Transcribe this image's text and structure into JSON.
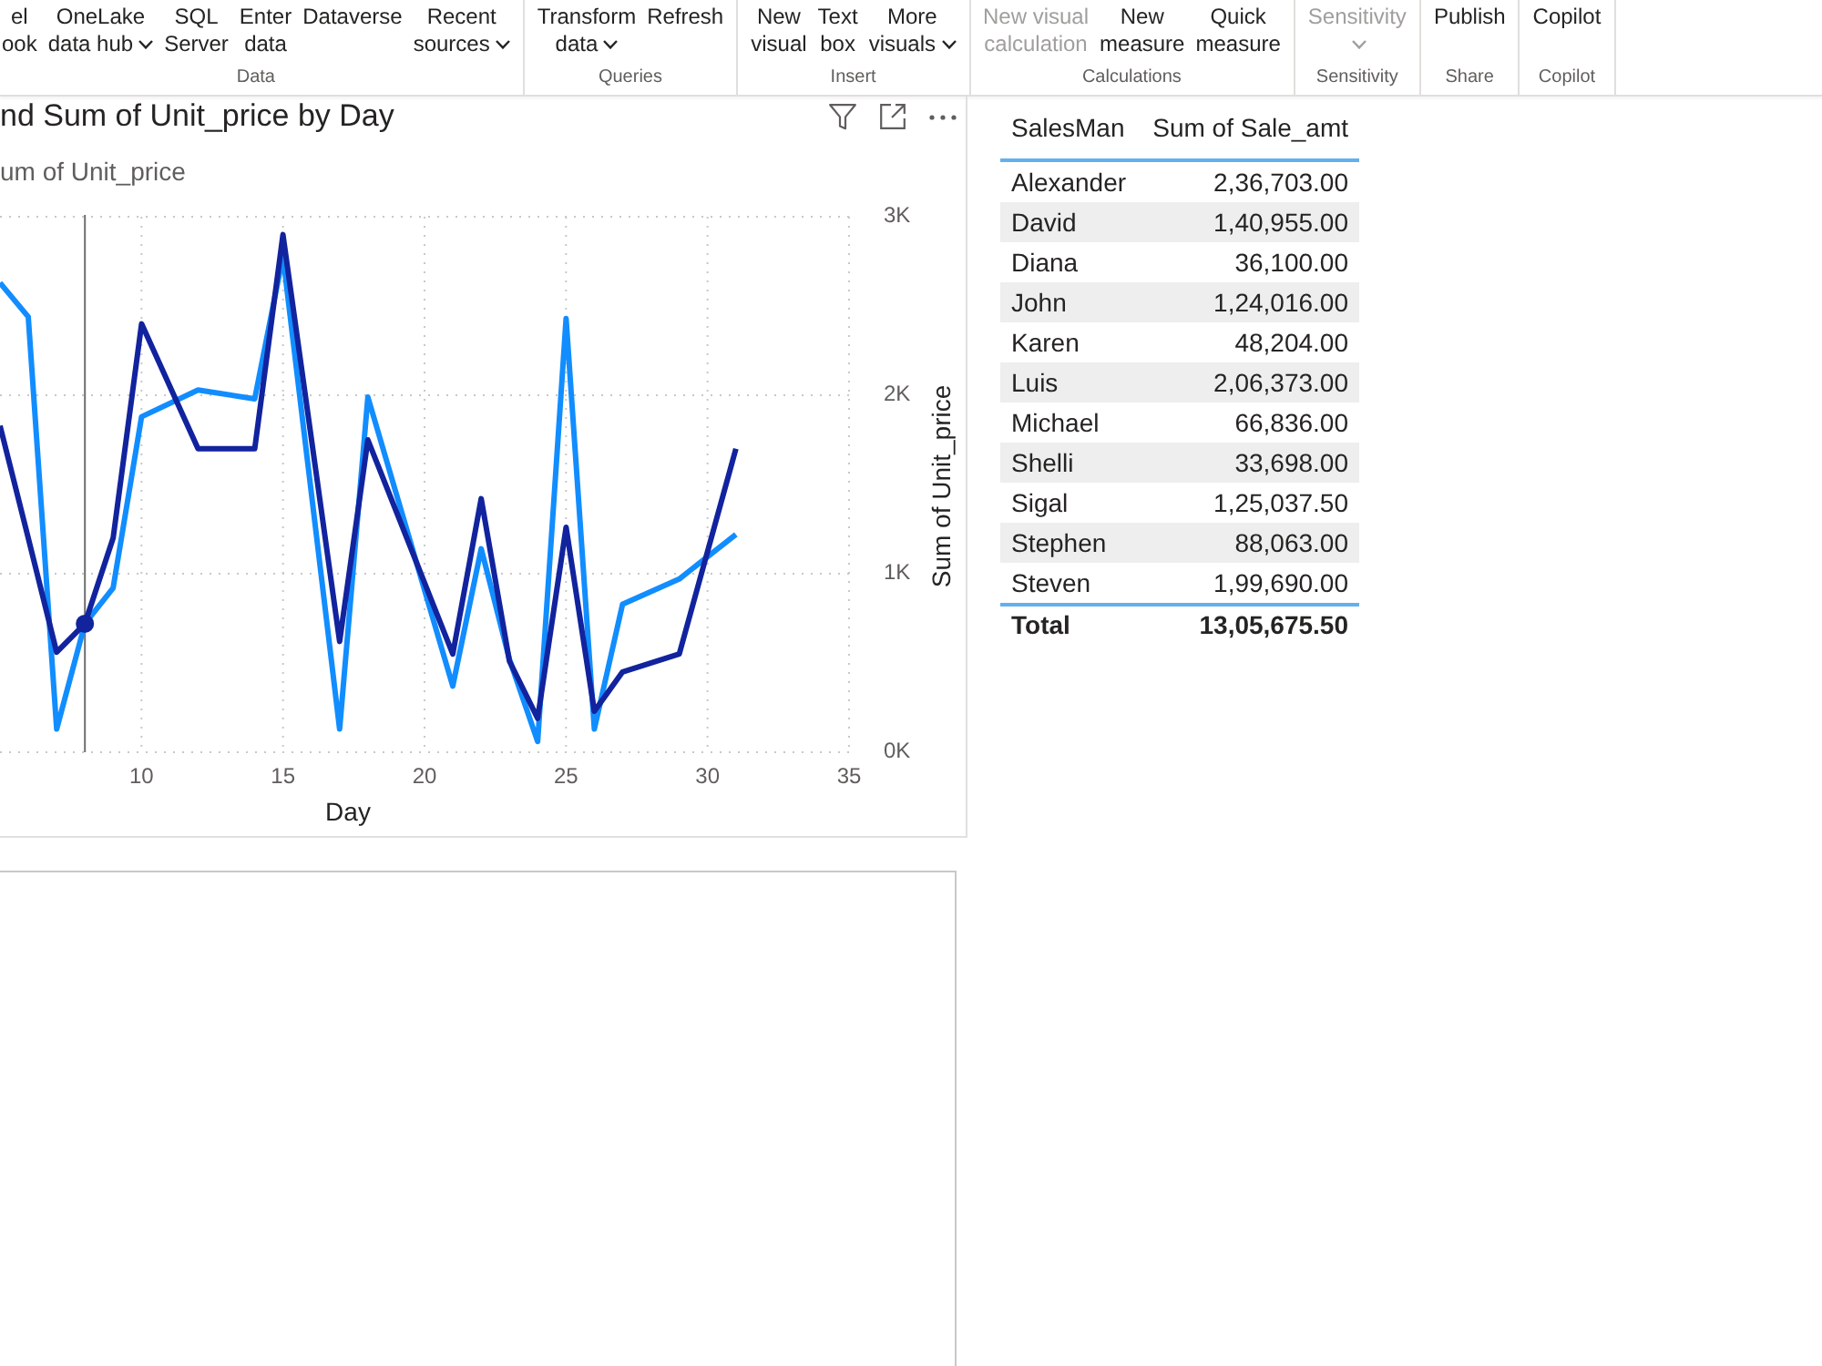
{
  "ribbon": {
    "groups": [
      {
        "label": "Data",
        "buttons": [
          {
            "lines": [
              "el",
              "ook"
            ],
            "dropdown": false,
            "disabled": false
          },
          {
            "lines": [
              "OneLake",
              "data hub"
            ],
            "dropdown": true,
            "disabled": false
          },
          {
            "lines": [
              "SQL",
              "Server"
            ],
            "dropdown": false,
            "disabled": false
          },
          {
            "lines": [
              "Enter",
              "data"
            ],
            "dropdown": false,
            "disabled": false
          },
          {
            "lines": [
              "Dataverse"
            ],
            "dropdown": false,
            "disabled": false
          },
          {
            "lines": [
              "Recent",
              "sources"
            ],
            "dropdown": true,
            "disabled": false
          }
        ]
      },
      {
        "label": "Queries",
        "buttons": [
          {
            "lines": [
              "Transform",
              "data"
            ],
            "dropdown": true,
            "disabled": false
          },
          {
            "lines": [
              "Refresh"
            ],
            "dropdown": false,
            "disabled": false
          }
        ]
      },
      {
        "label": "Insert",
        "buttons": [
          {
            "lines": [
              "New",
              "visual"
            ],
            "dropdown": false,
            "disabled": false
          },
          {
            "lines": [
              "Text",
              "box"
            ],
            "dropdown": false,
            "disabled": false
          },
          {
            "lines": [
              "More",
              "visuals"
            ],
            "dropdown": true,
            "disabled": false
          }
        ]
      },
      {
        "label": "Calculations",
        "buttons": [
          {
            "lines": [
              "New visual",
              "calculation"
            ],
            "dropdown": false,
            "disabled": true
          },
          {
            "lines": [
              "New",
              "measure"
            ],
            "dropdown": false,
            "disabled": false
          },
          {
            "lines": [
              "Quick",
              "measure"
            ],
            "dropdown": false,
            "disabled": false
          }
        ]
      },
      {
        "label": "Sensitivity",
        "buttons": [
          {
            "lines": [
              "Sensitivity"
            ],
            "dropdown": true,
            "disabled": true
          }
        ]
      },
      {
        "label": "Share",
        "buttons": [
          {
            "lines": [
              "Publish"
            ],
            "dropdown": false,
            "disabled": false
          }
        ]
      },
      {
        "label": "Copilot",
        "buttons": [
          {
            "lines": [
              "Copilot"
            ],
            "dropdown": false,
            "disabled": false
          }
        ]
      }
    ]
  },
  "line_visual": {
    "legend": "um of Unit_price",
    "chart_data": {
      "type": "line",
      "title": "nd Sum of Unit_price by Day",
      "xlabel": "Day",
      "ylabel": "Sum of Unit_price",
      "x": [
        5,
        6,
        7,
        8,
        9,
        10,
        12,
        14,
        15,
        17,
        18,
        21,
        22,
        23,
        24,
        25,
        26,
        27,
        29,
        31
      ],
      "series": [
        {
          "color": "#118dff",
          "values": [
            2630,
            2440,
            130,
            720,
            920,
            1880,
            2030,
            1980,
            2780,
            130,
            1990,
            370,
            1140,
            520,
            60,
            2430,
            130,
            830,
            970,
            1220
          ]
        },
        {
          "color": "#12239e",
          "values": [
            1830,
            1200,
            560,
            720,
            1200,
            2400,
            1700,
            1700,
            2900,
            620,
            1750,
            550,
            1420,
            510,
            190,
            1260,
            230,
            450,
            550,
            1700
          ]
        }
      ],
      "xlim": [
        5,
        35
      ],
      "xticks": [
        10,
        15,
        20,
        25,
        30,
        35
      ],
      "ylim": [
        0,
        3000
      ],
      "yticks": [
        {
          "value": 0,
          "label": "0K"
        },
        {
          "value": 1000,
          "label": "1K"
        },
        {
          "value": 2000,
          "label": "2K"
        },
        {
          "value": 3000,
          "label": "3K"
        }
      ],
      "grid": true,
      "ref_lines": [
        {
          "axis": "x",
          "value": 8,
          "color": "#6e6e6e",
          "line_style": "solid"
        }
      ]
    }
  },
  "table": {
    "columns": [
      "SalesMan",
      "Sum of Sale_amt"
    ],
    "rows": [
      [
        "Alexander",
        "2,36,703.00"
      ],
      [
        "David",
        "1,40,955.00"
      ],
      [
        "Diana",
        "36,100.00"
      ],
      [
        "John",
        "1,24,016.00"
      ],
      [
        "Karen",
        "48,204.00"
      ],
      [
        "Luis",
        "2,06,373.00"
      ],
      [
        "Michael",
        "66,836.00"
      ],
      [
        "Shelli",
        "33,698.00"
      ],
      [
        "Sigal",
        "1,25,037.50"
      ],
      [
        "Stephen",
        "88,063.00"
      ],
      [
        "Steven",
        "1,99,690.00"
      ]
    ],
    "total": [
      "Total",
      "13,05,675.50"
    ]
  }
}
